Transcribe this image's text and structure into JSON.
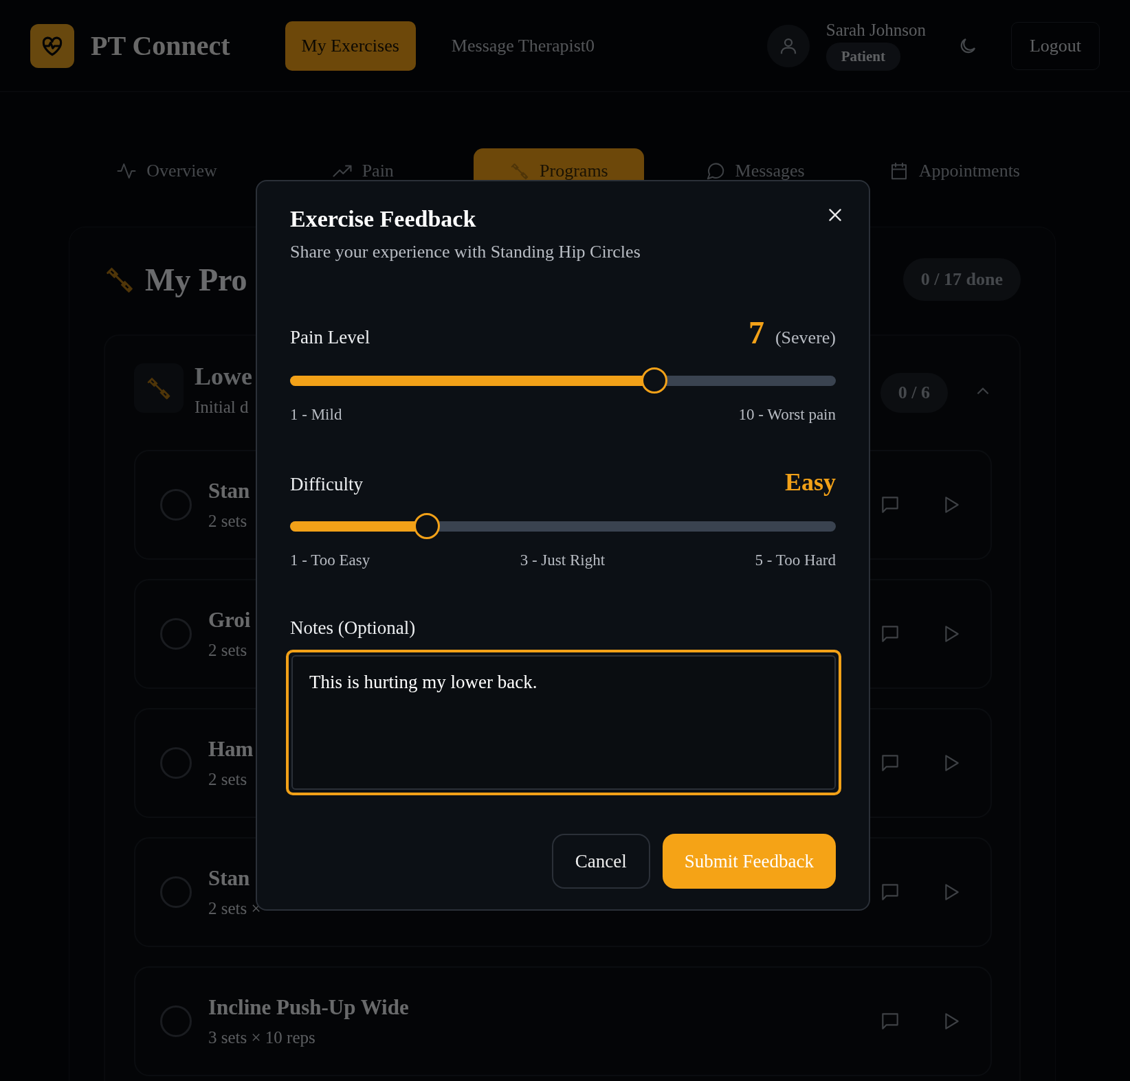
{
  "header": {
    "logo_title": "PT Connect",
    "nav": [
      {
        "label": "My Exercises",
        "selected": true
      },
      {
        "label": "Message Therapist0",
        "selected": false
      }
    ],
    "user": {
      "name": "Sarah Johnson",
      "role": "Patient"
    },
    "logout": "Logout"
  },
  "tabs": [
    {
      "label": "Overview",
      "kind": "activity",
      "selected": false
    },
    {
      "label": "Pain",
      "kind": "trend",
      "selected": false
    },
    {
      "label": "Programs",
      "kind": "dumbbell",
      "selected": true
    },
    {
      "label": "Messages",
      "kind": "chat",
      "selected": false
    },
    {
      "label": "Appointments",
      "kind": "calendar",
      "selected": false
    }
  ],
  "program": {
    "title": "My Pro",
    "progress": "0 / 17 done",
    "section": {
      "title": "Lowe",
      "subtitle": "Initial d",
      "count": "0 / 6",
      "expanded": true,
      "exercises": [
        {
          "name": "Stan",
          "detail": "2 sets",
          "done": false
        },
        {
          "name": "Groi",
          "detail": "2 sets",
          "done": false
        },
        {
          "name": "Ham",
          "detail": "2 sets",
          "done": false
        },
        {
          "name": "Stan",
          "detail": "2 sets ×",
          "done": false
        },
        {
          "name": "Incline Push-Up Wide",
          "detail": "3 sets × 10 reps",
          "done": false
        }
      ]
    }
  },
  "modal": {
    "title": "Exercise Feedback",
    "subtitle": "Share your experience with Standing Hip Circles",
    "pain": {
      "label": "Pain Level",
      "value": "7",
      "descriptor": "(Severe)",
      "level": 0.667,
      "min_label": "1 - Mild",
      "max_label": "10 - Worst pain"
    },
    "difficulty": {
      "label": "Difficulty",
      "value": "Easy",
      "level": 0.25,
      "scale_labels": [
        "1 - Too Easy",
        "3 - Just Right",
        "5 - Too Hard"
      ]
    },
    "notes": {
      "label": "Notes (Optional)",
      "value": "This is hurting my lower back.",
      "focused": true
    },
    "buttons": [
      {
        "label": "Cancel",
        "kind": "secondary"
      },
      {
        "label": "Submit Feedback",
        "kind": "primary"
      }
    ]
  }
}
